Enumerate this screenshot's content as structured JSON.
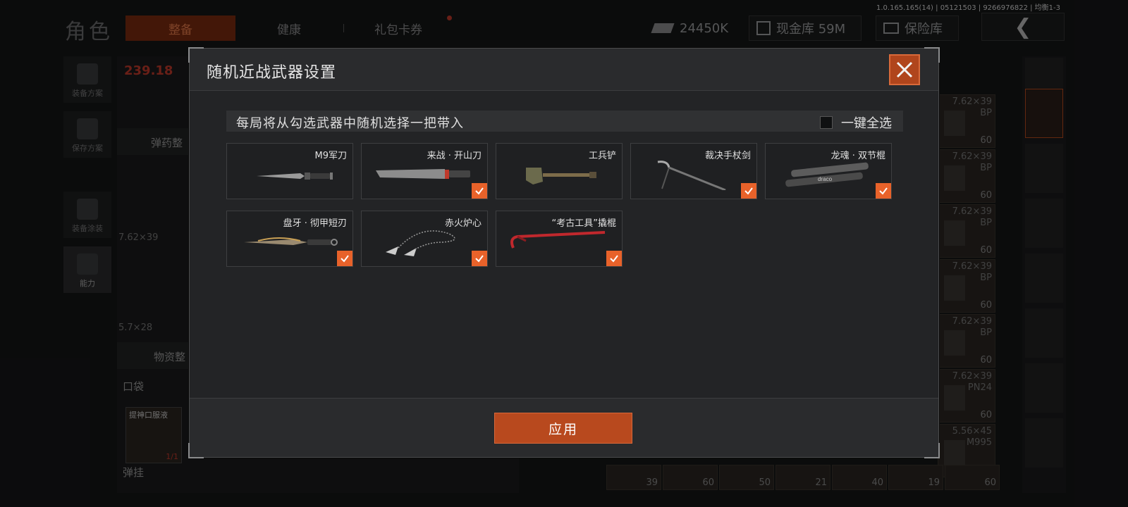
{
  "background": {
    "version": "1.0.165.165(14) | 05121503 | 9266976822 | 均衡1-3",
    "page_title": "角色",
    "tabs": [
      {
        "label": "整备"
      },
      {
        "label": "健康"
      },
      {
        "label": "礼包卡券"
      }
    ],
    "currency": {
      "coins": "24450K",
      "cash_vault": "现金库 59M",
      "safe": "保险库"
    },
    "left_rail": [
      {
        "label": "装备方案"
      },
      {
        "label": "保存方案"
      },
      {
        "label": "装备涂装"
      },
      {
        "label": "能力"
      }
    ],
    "left_panel": {
      "weight": "239.18",
      "ammo_sort": "弹药整",
      "caliber1": "7.62×39",
      "caliber2": "5.7×28",
      "supplies": "物资整",
      "pocket": "口袋",
      "item_name": "提神口服液",
      "item_count": "1/1",
      "sling": "弹挂"
    },
    "ammo_column": [
      {
        "caliber": "7.62×39",
        "type": "BP",
        "count": "60"
      },
      {
        "caliber": "7.62×39",
        "type": "BP",
        "count": "60"
      },
      {
        "caliber": "7.62×39",
        "type": "BP",
        "count": "60"
      },
      {
        "caliber": "7.62×39",
        "type": "BP",
        "count": "60"
      },
      {
        "caliber": "7.62×39",
        "type": "BP",
        "count": "60"
      },
      {
        "caliber": "7.62×39",
        "type": "PN24",
        "count": "60"
      },
      {
        "caliber": "5.56×45",
        "type": "M995",
        "count": "60"
      }
    ],
    "bottom_counts": [
      "39",
      "60",
      "50",
      "21",
      "40",
      "19",
      "60"
    ]
  },
  "modal": {
    "title": "随机近战武器设置",
    "info": "每局将从勾选武器中随机选择一把带入",
    "select_all_label": "一键全选",
    "select_all_checked": false,
    "weapons": [
      {
        "name": "M9军刀",
        "checked": false,
        "icon": "knife-icon"
      },
      {
        "name": "来战 · 开山刀",
        "checked": true,
        "icon": "machete-icon"
      },
      {
        "name": "工兵铲",
        "checked": false,
        "icon": "shovel-icon"
      },
      {
        "name": "裁决手杖剑",
        "checked": true,
        "icon": "cane-sword-icon"
      },
      {
        "name": "龙魂 · 双节棍",
        "checked": true,
        "icon": "nunchaku-icon"
      },
      {
        "name": "盘牙 · 彻甲短刃",
        "checked": true,
        "icon": "short-blade-icon"
      },
      {
        "name": "赤火炉心",
        "checked": true,
        "icon": "kunai-chain-icon"
      },
      {
        "name": "“考古工具”撬棍",
        "checked": true,
        "icon": "crowbar-icon"
      }
    ],
    "apply_label": "应用",
    "accent_color": "#e8622a"
  }
}
